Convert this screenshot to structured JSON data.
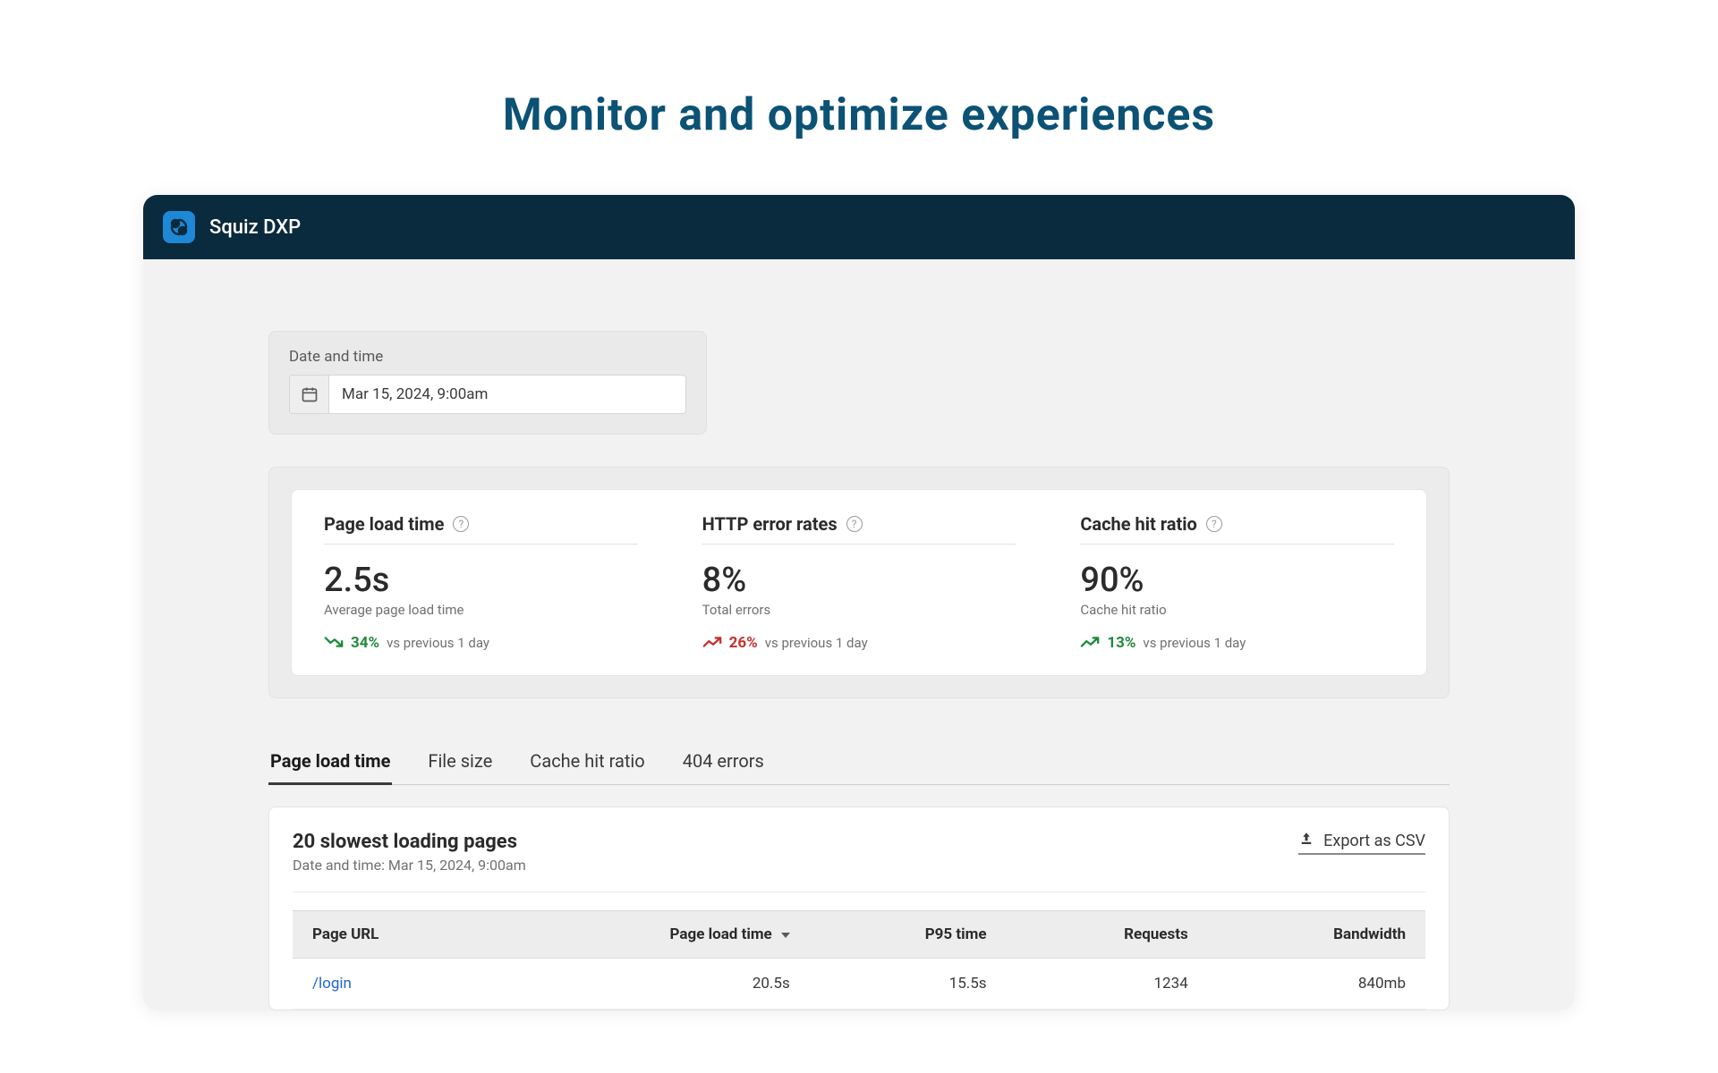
{
  "page": {
    "hero_title": "Monitor and optimize experiences",
    "app_name": "Squiz DXP"
  },
  "datetime": {
    "label": "Date and time",
    "value": "Mar 15, 2024, 9:00am"
  },
  "metrics": [
    {
      "title": "Page load time",
      "value": "2.5s",
      "subtitle": "Average page load time",
      "trend_direction": "down",
      "trend_color": "green",
      "delta": "34%",
      "compare": "vs previous 1 day"
    },
    {
      "title": "HTTP error rates",
      "value": "8%",
      "subtitle": "Total errors",
      "trend_direction": "up",
      "trend_color": "red",
      "delta": "26%",
      "compare": "vs previous 1 day"
    },
    {
      "title": "Cache hit ratio",
      "value": "90%",
      "subtitle": "Cache hit ratio",
      "trend_direction": "up",
      "trend_color": "green",
      "delta": "13%",
      "compare": "vs previous 1 day"
    }
  ],
  "tabs": [
    {
      "label": "Page load time",
      "active": true
    },
    {
      "label": "File size",
      "active": false
    },
    {
      "label": "Cache hit ratio",
      "active": false
    },
    {
      "label": "404 errors",
      "active": false
    }
  ],
  "table": {
    "title": "20 slowest loading pages",
    "subtitle": "Date and time: Mar 15, 2024, 9:00am",
    "export_label": "Export as CSV",
    "columns": [
      {
        "label": "Page URL",
        "sort": false
      },
      {
        "label": "Page load time",
        "sort": true
      },
      {
        "label": "P95 time",
        "sort": false
      },
      {
        "label": "Requests",
        "sort": false
      },
      {
        "label": "Bandwidth",
        "sort": false
      }
    ],
    "rows": [
      {
        "url": "/login",
        "load": "20.5s",
        "p95": "15.5s",
        "requests": "1234",
        "bandwidth": "840mb"
      }
    ]
  }
}
